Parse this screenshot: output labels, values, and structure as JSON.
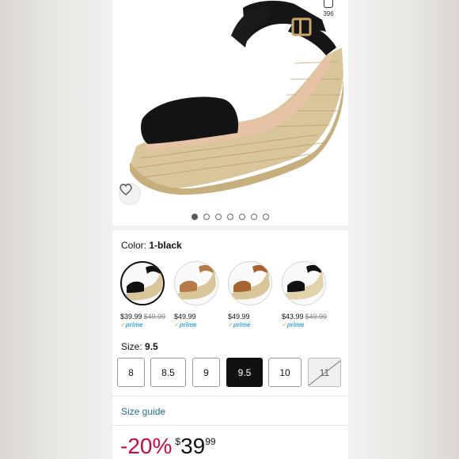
{
  "product": {
    "image_share_count": "396",
    "gallery_dots": [
      true,
      false,
      false,
      false,
      false,
      false,
      false
    ]
  },
  "color": {
    "label": "Color:",
    "selected": "1-black",
    "swatches": [
      {
        "name": "black",
        "price": "$39.99",
        "list_price": "$49.99",
        "prime": "prime",
        "selected": true
      },
      {
        "name": "tan",
        "price": "$49.99",
        "list_price": "",
        "prime": "prime",
        "selected": false
      },
      {
        "name": "brown",
        "price": "$49.99",
        "list_price": "",
        "prime": "prime",
        "selected": false
      },
      {
        "name": "black-natural",
        "price": "$43.99",
        "list_price": "$49.99",
        "prime": "prime",
        "selected": false
      }
    ]
  },
  "size": {
    "label": "Size:",
    "selected": "9.5",
    "options": [
      {
        "label": "8",
        "state": "available"
      },
      {
        "label": "8.5",
        "state": "available"
      },
      {
        "label": "9",
        "state": "available"
      },
      {
        "label": "9.5",
        "state": "selected"
      },
      {
        "label": "10",
        "state": "available"
      },
      {
        "label": "11",
        "state": "unavailable"
      }
    ],
    "guide_link": "Size guide"
  },
  "price": {
    "discount": "-20%",
    "currency": "$",
    "whole": "39",
    "fraction": "99"
  },
  "icons": {
    "share": "share-icon",
    "favorite": "heart-icon"
  },
  "colors": {
    "link": "#1f6f8b",
    "discount": "#cc0c39",
    "prime": "#3aa8d8",
    "selected_size_bg": "#111111"
  }
}
